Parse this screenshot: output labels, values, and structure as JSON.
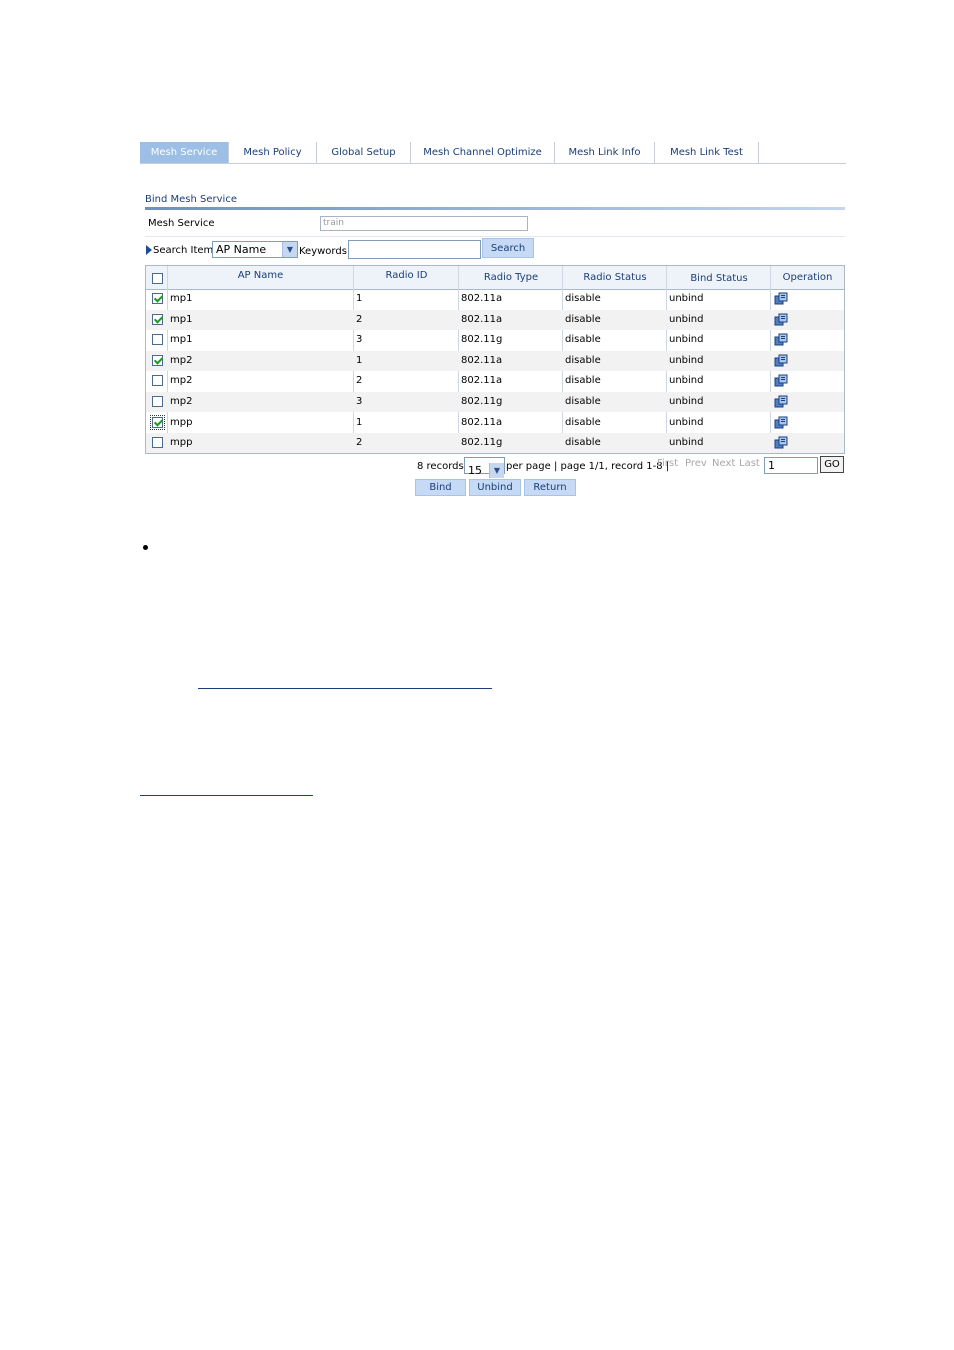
{
  "tabs": [
    {
      "label": "Mesh Service",
      "active": true
    },
    {
      "label": "Mesh Policy",
      "active": false
    },
    {
      "label": "Global Setup",
      "active": false
    },
    {
      "label": "Mesh Channel Optimize",
      "active": false
    },
    {
      "label": "Mesh Link Info",
      "active": false
    },
    {
      "label": "Mesh Link Test",
      "active": false
    }
  ],
  "section": {
    "title": "Bind Mesh Service"
  },
  "mesh_service": {
    "label": "Mesh Service",
    "value": "train"
  },
  "search": {
    "item_label": "Search Item:",
    "item_selected": "AP Name",
    "keywords_label": "Keywords:",
    "keywords_value": "",
    "button": "Search"
  },
  "table": {
    "headers": [
      "AP Name",
      "Radio ID",
      "Radio Type",
      "Radio Status",
      "Bind Status",
      "Operation"
    ],
    "rows": [
      {
        "ap_name": "mp1",
        "radio_id": "1",
        "radio_type": "802.11a",
        "radio_status": "disable",
        "bind_status": "unbind",
        "checked": true
      },
      {
        "ap_name": "mp1",
        "radio_id": "2",
        "radio_type": "802.11a",
        "radio_status": "disable",
        "bind_status": "unbind",
        "checked": true
      },
      {
        "ap_name": "mp1",
        "radio_id": "3",
        "radio_type": "802.11g",
        "radio_status": "disable",
        "bind_status": "unbind",
        "checked": false
      },
      {
        "ap_name": "mp2",
        "radio_id": "1",
        "radio_type": "802.11a",
        "radio_status": "disable",
        "bind_status": "unbind",
        "checked": true
      },
      {
        "ap_name": "mp2",
        "radio_id": "2",
        "radio_type": "802.11a",
        "radio_status": "disable",
        "bind_status": "unbind",
        "checked": false
      },
      {
        "ap_name": "mp2",
        "radio_id": "3",
        "radio_type": "802.11g",
        "radio_status": "disable",
        "bind_status": "unbind",
        "checked": false
      },
      {
        "ap_name": "mpp",
        "radio_id": "1",
        "radio_type": "802.11a",
        "radio_status": "disable",
        "bind_status": "unbind",
        "checked": true
      },
      {
        "ap_name": "mpp",
        "radio_id": "2",
        "radio_type": "802.11g",
        "radio_status": "disable",
        "bind_status": "unbind",
        "checked": false
      }
    ],
    "operation_icon": "edit-icon"
  },
  "pager": {
    "records": "8 records,",
    "per_page_value": "15",
    "per_page_text": "per page | page 1/1, record 1-8 |",
    "first": "First",
    "prev": "Prev",
    "next": "Next",
    "last": "Last",
    "page_value": "1",
    "go": "GO"
  },
  "actions": {
    "bind": "Bind",
    "unbind": "Unbind",
    "return": "Return"
  },
  "colors": {
    "tab_active": "#9dbfe6",
    "link": "#1a3e78",
    "header_bg": "#eef3fa",
    "check": "#1f9a1f"
  }
}
